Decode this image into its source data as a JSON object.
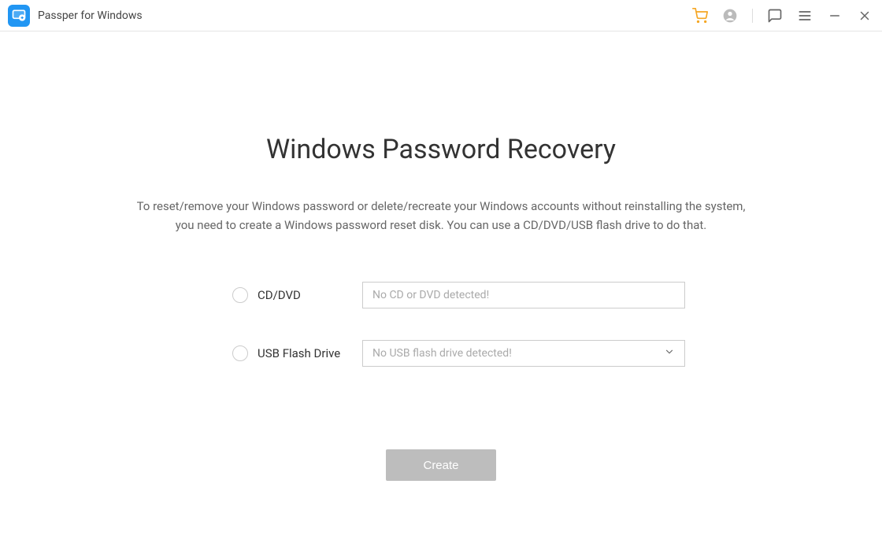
{
  "titlebar": {
    "app_name": "Passper for Windows"
  },
  "main": {
    "heading": "Windows Password Recovery",
    "subtext_line1": "To reset/remove your Windows password or delete/recreate your Windows accounts without reinstalling the system,",
    "subtext_line2": "you need to create a Windows password reset disk. You can use a CD/DVD/USB flash drive to do that."
  },
  "options": {
    "cddvd": {
      "label": "CD/DVD",
      "placeholder": "No CD or DVD detected!"
    },
    "usb": {
      "label": "USB Flash Drive",
      "placeholder": "No USB flash drive detected!"
    }
  },
  "actions": {
    "create_label": "Create"
  }
}
